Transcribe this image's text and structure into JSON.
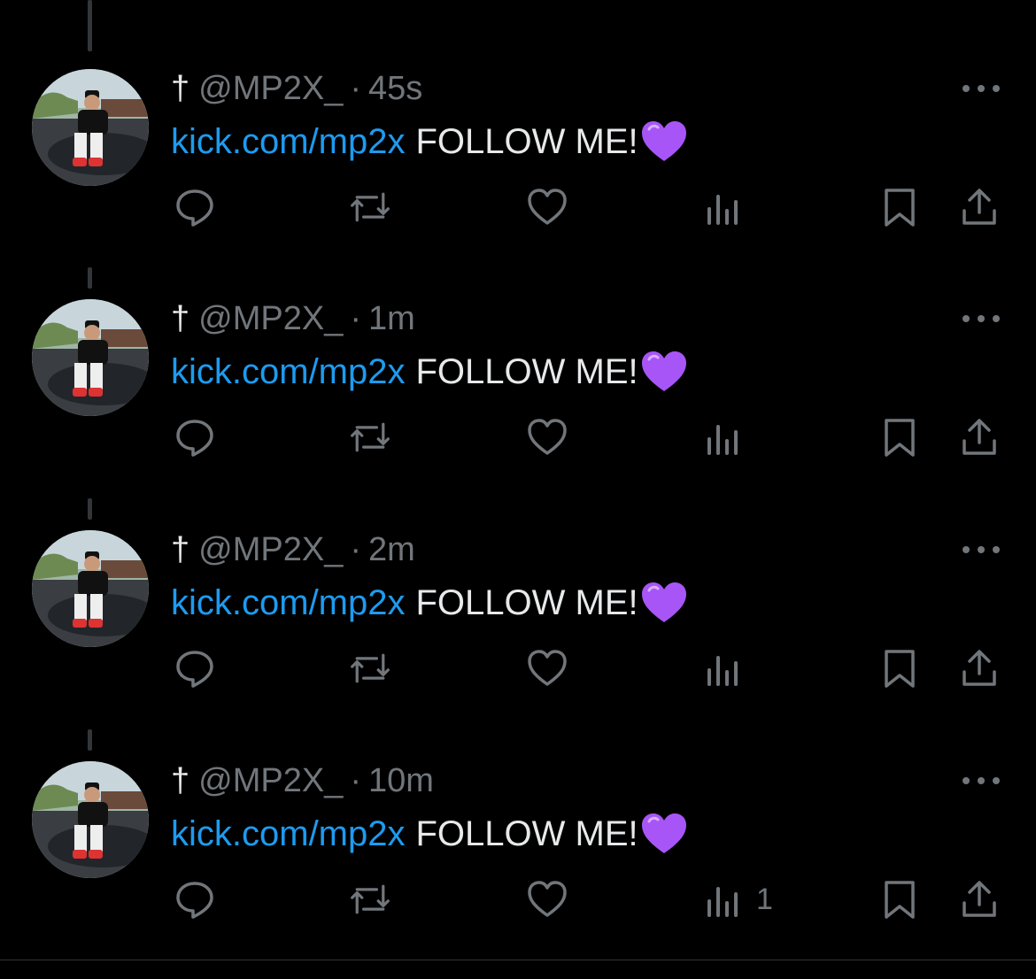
{
  "colors": {
    "background": "#000000",
    "link": "#1d9bf0",
    "text": "#e7e9ea",
    "muted": "#71767b",
    "heart_emoji": "#a855f7"
  },
  "icons": {
    "reply": "speech-bubble-icon",
    "repost": "repost-arrows-icon",
    "like": "heart-outline-icon",
    "views": "bar-chart-icon",
    "bookmark": "bookmark-icon",
    "share": "share-upload-icon",
    "more": "ellipsis-icon",
    "emoji": "purple-heart-emoji"
  },
  "tweets": [
    {
      "cross": "†",
      "handle": "@MP2X_",
      "separator": "·",
      "time": "45s",
      "link_text": "kick.com/mp2x",
      "message": "FOLLOW ME!",
      "views_count": ""
    },
    {
      "cross": "†",
      "handle": "@MP2X_",
      "separator": "·",
      "time": "1m",
      "link_text": "kick.com/mp2x",
      "message": "FOLLOW ME!",
      "views_count": ""
    },
    {
      "cross": "†",
      "handle": "@MP2X_",
      "separator": "·",
      "time": "2m",
      "link_text": "kick.com/mp2x",
      "message": "FOLLOW ME!",
      "views_count": ""
    },
    {
      "cross": "†",
      "handle": "@MP2X_",
      "separator": "·",
      "time": "10m",
      "link_text": "kick.com/mp2x",
      "message": "FOLLOW ME!",
      "views_count": "1"
    }
  ]
}
